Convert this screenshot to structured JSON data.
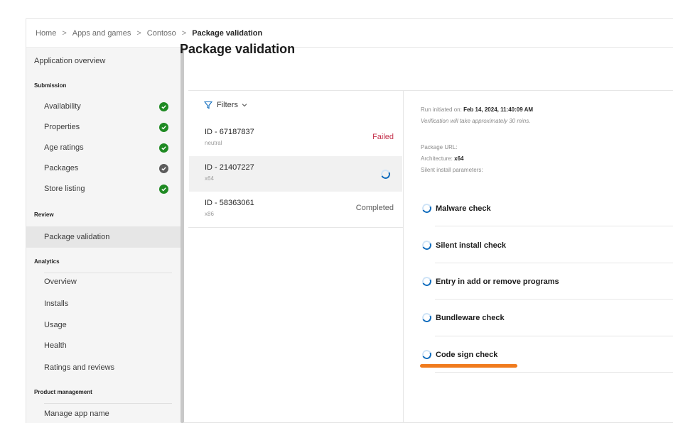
{
  "breadcrumb": {
    "items": [
      "Home",
      "Apps and games",
      "Contoso"
    ],
    "current": "Package validation",
    "separator": ">"
  },
  "sidebar": {
    "overview": "Application overview",
    "sections": {
      "submission": "Submission",
      "review": "Review",
      "analytics": "Analytics",
      "product_management": "Product management"
    },
    "submission_items": [
      {
        "label": "Availability",
        "status": "complete"
      },
      {
        "label": "Properties",
        "status": "complete"
      },
      {
        "label": "Age ratings",
        "status": "complete"
      },
      {
        "label": "Packages",
        "status": "pending"
      },
      {
        "label": "Store listing",
        "status": "complete"
      }
    ],
    "review_items": [
      "Package validation"
    ],
    "analytics_items": [
      "Overview",
      "Installs",
      "Usage",
      "Health",
      "Ratings and reviews"
    ],
    "product_management_items": [
      "Manage app name"
    ]
  },
  "main": {
    "title": "Package validation",
    "filters_label": "Filters",
    "packages": [
      {
        "id": "ID - 67187837",
        "arch": "neutral",
        "status": "Failed"
      },
      {
        "id": "ID - 21407227",
        "arch": "x64",
        "status": "in-progress"
      },
      {
        "id": "ID - 58363061",
        "arch": "x86",
        "status": "Completed"
      }
    ]
  },
  "details": {
    "run_initiated_label": "Run initiated on:",
    "run_initiated_value": "Feb 14, 2024, 11:40:09 AM",
    "verification_note": "Verification will take approximately 30 mins.",
    "package_url_label": "Package URL:",
    "architecture_label": "Architecture:",
    "architecture_value": "x64",
    "silent_params_label": "Silent install parameters:",
    "checks": [
      "Malware check",
      "Silent install check",
      "Entry in add or remove programs",
      "Bundleware check",
      "Code sign check"
    ]
  },
  "colors": {
    "accent": "#0f6cbd",
    "success": "#1f8a23",
    "failed": "#c4314b",
    "highlight_underline": "#f07b1d"
  },
  "icons": {
    "filter": "funnel-icon",
    "status_complete": "check-circle-icon",
    "status_pending": "check-circle-gray-icon",
    "in_progress": "spinner-icon"
  }
}
